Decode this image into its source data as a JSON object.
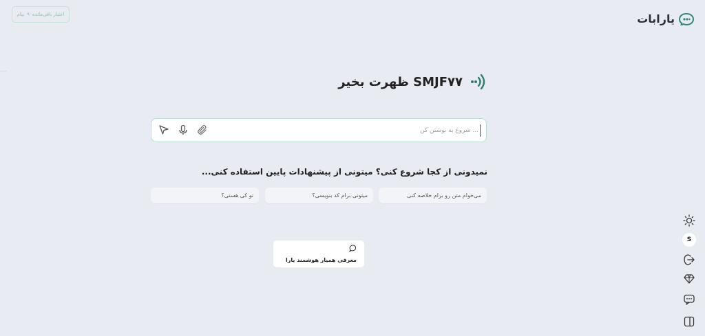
{
  "header": {
    "credits_text": "اعتبار باقی‌مانده",
    "credits_count": "۹",
    "credits_unit": "پیام",
    "brand_name": "یارابات"
  },
  "main": {
    "greeting": "ظهرت بخیر SMJF۷۷",
    "input_placeholder": "شروع به نوشتن کن ...",
    "suggest_heading": "نمیدونی از کجا شروع کنی؟ میتونی از پیشنهادات پایین استفاده کنی...",
    "suggestions": [
      "می‌خوام متن رو برام خلاصه کنی",
      "میتونی برام کد بنویسی؟",
      "تو کی هستی؟"
    ],
    "intro_card_label": "معرفی همیار هوشمند یارا"
  },
  "sidebar": {
    "avatar_letter": "S"
  },
  "colors": {
    "accent": "#2f7d6d",
    "background": "#e9ebf2",
    "input_border": "#b8ddd4"
  },
  "icons": [
    "sun-icon",
    "logout-icon",
    "gem-icon",
    "chat-bubble-icon",
    "panel-icon",
    "send-icon",
    "mic-icon",
    "paperclip-icon",
    "brand-logo-icon"
  ]
}
